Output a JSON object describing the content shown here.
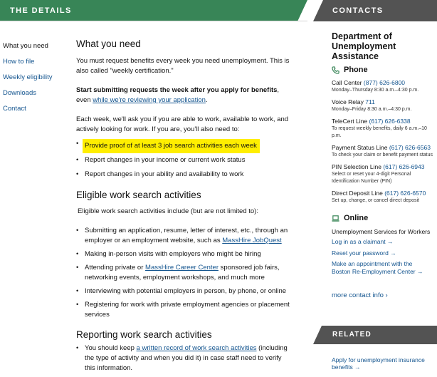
{
  "header": {
    "details_title": "THE DETAILS",
    "contacts_title": "CONTACTS"
  },
  "nav": {
    "items": [
      {
        "label": "What you need"
      },
      {
        "label": "How to file"
      },
      {
        "label": "Weekly eligibility"
      },
      {
        "label": "Downloads"
      },
      {
        "label": "Contact"
      }
    ]
  },
  "main": {
    "heading1": "What you need",
    "intro": "You must request benefits every week you need unemployment. This is also called \"weekly certification.\"",
    "start_bold": "Start submitting requests the week after you apply for benefits",
    "start_tail": ", even",
    "review_link": "while we're reviewing your application",
    "period": ".",
    "each_week": "Each week, we'll ask you if you are able to work, available to work, and actively looking for work. If you are, you'll also need to:",
    "need_items": [
      "Provide proof of at least 3 job search activities each week",
      "Report changes in your income or current work status",
      "Report changes in your ability and availability to work"
    ],
    "heading2": "Eligible work search activities",
    "eligible_intro": "Eligible work search activities include (but are not limited to):",
    "activity_1a": "Submitting an application, resume, letter of interest, etc., through an employer or an employment website, such as ",
    "activity_1_link": "MassHire JobQuest",
    "activity_2": "Making in-person visits with employers who might be hiring",
    "activity_3a": "Attending private or ",
    "activity_3_link": "MassHire Career Center",
    "activity_3b": " sponsored job fairs, networking events, employment workshops, and much more",
    "activity_4": "Interviewing with potential employers in person, by phone, or online",
    "activity_5": "Registering for work with private employment agencies or placement services",
    "heading3": "Reporting work search activities",
    "report_a": "You should keep ",
    "report_link": "a written record of work search activities",
    "report_b": " (including the type of activity and when you did it) in case staff need to verify this information."
  },
  "sidebar": {
    "org": "Department of Unemployment Assistance",
    "phone_heading": "Phone",
    "call_center_label": "Call Center",
    "call_center_num": "(877) 626-6800",
    "call_center_hours": "Monday–Thursday 8:30 a.m.–4:30 p.m.",
    "voice_relay_label": "Voice Relay",
    "voice_relay_num": "711",
    "voice_relay_hours": "Monday–Friday 8:30 a.m.–4:30 p.m.",
    "telecert_label": "TeleCert Line",
    "telecert_num": "(617) 626-6338",
    "telecert_note": "To request weekly benefits, daily 6 a.m.–10 p.m.",
    "payment_label": "Payment Status Line",
    "payment_num": "(617) 626-6563",
    "payment_note": "To check your claim or benefit payment status",
    "pin_label": "PIN Selection Line",
    "pin_num": "(617) 626-6943",
    "pin_note": "Select or reset your 4-digit Personal Identification Number (PIN)",
    "deposit_label": "Direct Deposit Line",
    "deposit_num": "(617) 626-6570",
    "deposit_note": "Set up, change, or cancel direct deposit",
    "online_heading": "Online",
    "online_desc": "Unemployment Services for Workers",
    "login_link": "Log in as a claimant →",
    "reset_link": "Reset your password →",
    "appointment_link": "Make an appointment with the Boston Re-Employment Center →",
    "more_contact": "more contact info",
    "more_contact_arrow": "›",
    "related_title": "RELATED",
    "related_link": "Apply for unemployment insurance benefits →"
  },
  "colors": {
    "green_banner": "#388557",
    "gray_banner": "#535353",
    "link": "#14558f",
    "highlight": "#ffee00"
  }
}
